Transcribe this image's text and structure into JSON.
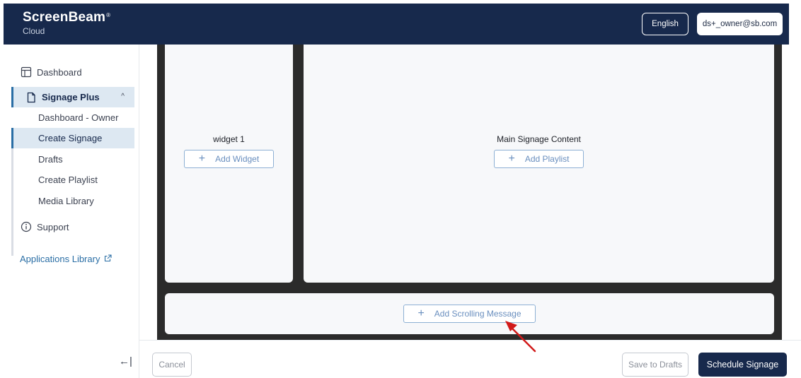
{
  "header": {
    "brand_name": "ScreenBeam",
    "brand_mark": "®",
    "brand_sub": "Cloud",
    "language": "English",
    "user_email": "ds+_owner@sb.com"
  },
  "sidebar": {
    "dashboard": "Dashboard",
    "signage_plus": "Signage Plus",
    "sub_items": [
      {
        "label": "Dashboard - Owner",
        "active": false
      },
      {
        "label": "Create Signage",
        "active": true
      },
      {
        "label": "Drafts",
        "active": false
      },
      {
        "label": "Create Playlist",
        "active": false
      },
      {
        "label": "Media Library",
        "active": false
      }
    ],
    "support": "Support",
    "applications_library": "Applications Library",
    "collapse_glyph": "←|"
  },
  "canvas": {
    "widget_title": "widget 1",
    "widget_button": "Add Widget",
    "main_title": "Main Signage Content",
    "main_button": "Add Playlist",
    "scroll_button": "Add Scrolling Message"
  },
  "footer": {
    "cancel": "Cancel",
    "save_drafts": "Save to Drafts",
    "schedule": "Schedule Signage"
  },
  "colors": {
    "navy": "#17294c",
    "accent": "#2a6ea5",
    "arrow": "#d11a1a"
  },
  "icons": [
    "layout-icon",
    "document-icon",
    "chevron-up-icon",
    "info-circle-icon",
    "external-link-icon",
    "plus-icon",
    "collapse-sidebar-icon"
  ]
}
